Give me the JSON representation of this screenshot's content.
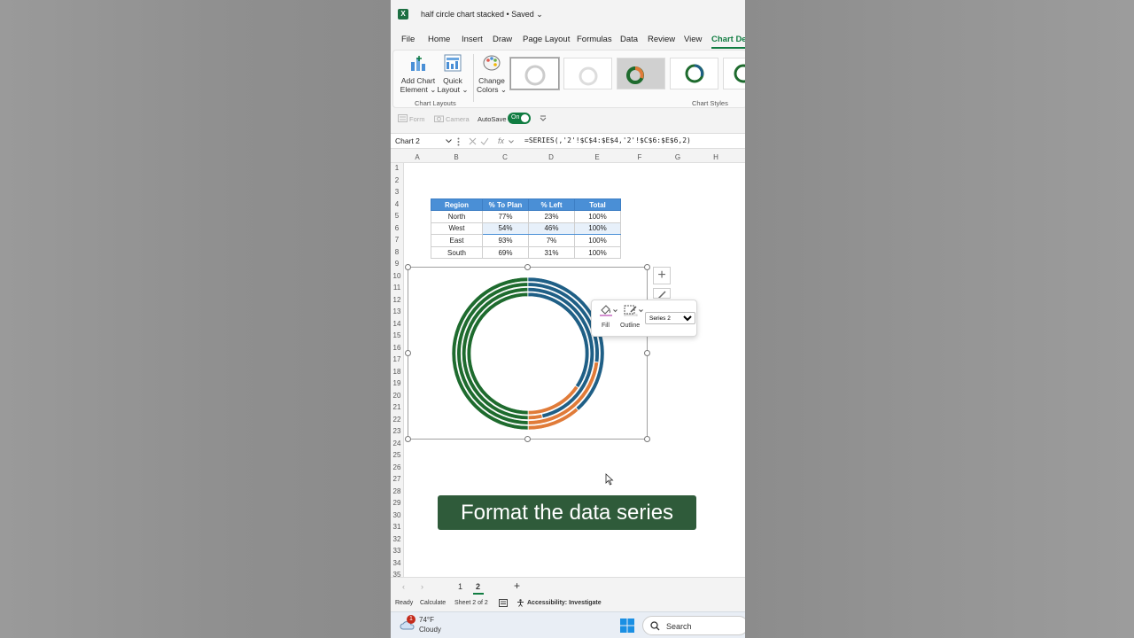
{
  "window": {
    "title": "half circle chart stacked • Saved ⌄",
    "app_icon": "excel-icon"
  },
  "menu": {
    "items": [
      "File",
      "Home",
      "Insert",
      "Draw",
      "Page Layout",
      "Formulas",
      "Data",
      "Review",
      "View",
      "Chart Des"
    ],
    "active": "Chart Des"
  },
  "ribbon": {
    "add_chart_element": [
      "Add Chart",
      "Element ⌄"
    ],
    "quick_layout": [
      "Quick",
      "Layout ⌄"
    ],
    "change_colors": [
      "Change",
      "Colors ⌄"
    ],
    "group_chart_layouts": "Chart Layouts",
    "group_chart_styles": "Chart Styles"
  },
  "qat": {
    "form": "Form",
    "camera": "Camera",
    "autosave": "AutoSave",
    "toggle": "On"
  },
  "formula_bar": {
    "name_box": "Chart 2",
    "fx": "fx",
    "formula": "=SERIES(,'2'!$C$4:$E$4,'2'!$C$6:$E$6,2)"
  },
  "columns": [
    "A",
    "B",
    "C",
    "D",
    "E",
    "F",
    "G",
    "H"
  ],
  "rows": [
    "1",
    "2",
    "3",
    "4",
    "5",
    "6",
    "7",
    "8",
    "9",
    "10",
    "11",
    "12",
    "13",
    "14",
    "15",
    "16",
    "17",
    "18",
    "19",
    "20",
    "21",
    "22",
    "23",
    "24",
    "25",
    "26",
    "27",
    "28",
    "29",
    "30",
    "31",
    "32",
    "33",
    "34",
    "35"
  ],
  "table": {
    "headers": [
      "Region",
      "% To Plan",
      "% Left",
      "Total"
    ],
    "rows": [
      [
        "North",
        "77%",
        "23%",
        "100%"
      ],
      [
        "West",
        "54%",
        "46%",
        "100%"
      ],
      [
        "East",
        "93%",
        "7%",
        "100%"
      ],
      [
        "South",
        "69%",
        "31%",
        "100%"
      ]
    ]
  },
  "chart_data": {
    "type": "doughnut",
    "categories": [
      "% To Plan",
      "% Left",
      "Total"
    ],
    "series": [
      {
        "values": [
          77,
          23,
          100
        ]
      },
      {
        "values": [
          54,
          46,
          100
        ]
      },
      {
        "values": [
          93,
          7,
          100
        ]
      },
      {
        "values": [
          69,
          31,
          100
        ]
      }
    ],
    "colors": {
      "to_plan": "#1f5f86",
      "left": "#e07b39",
      "total": "#1e6b2e"
    }
  },
  "format_popup": {
    "fill": "Fill",
    "outline": "Outline",
    "series_select": "Series 2"
  },
  "caption": "Format the data series",
  "sheets": {
    "tabs": [
      "1",
      "2"
    ],
    "active": "2",
    "add": "+"
  },
  "status": {
    "ready": "Ready",
    "calculate": "Calculate",
    "sheet": "Sheet 2 of 2",
    "accessibility": "Accessibility: Investigate"
  },
  "taskbar": {
    "temp": "74°F",
    "weather": "Cloudy",
    "notifications": "1",
    "search": "Search"
  }
}
